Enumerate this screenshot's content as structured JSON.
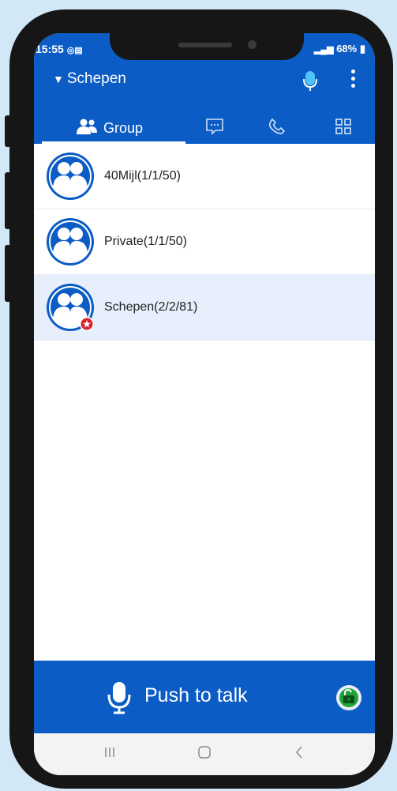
{
  "status": {
    "time": "15:55",
    "battery": "68%"
  },
  "appbar": {
    "title": "Schepen",
    "title_caret": "▼"
  },
  "tabs": {
    "group_label": "Group"
  },
  "groups": [
    {
      "label": "40Mijl(1/1/50)"
    },
    {
      "label": "Private(1/1/50)"
    },
    {
      "label": "Schepen(2/2/81)"
    }
  ],
  "ptt": {
    "label": "Push to talk"
  },
  "colors": {
    "brand": "#0b5cc5",
    "selected_row": "#e6effb",
    "badge": "#d6202f",
    "lock": "#21a33a"
  }
}
